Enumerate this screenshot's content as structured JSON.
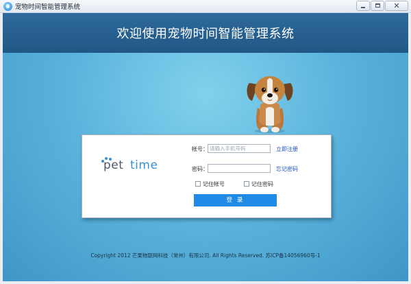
{
  "window": {
    "title": "宠物时间智能管理系统",
    "buttons": {
      "minimize": "minimize",
      "maximize": "maximize",
      "close": "✕"
    }
  },
  "header": {
    "title": "欢迎使用宠物时间智能管理系统"
  },
  "logo": {
    "text": "pet time"
  },
  "login": {
    "account_label": "帐号：",
    "account_placeholder": "请输入手机号码",
    "register_link": "立即注册",
    "password_label": "密码：",
    "password_value": "",
    "forgot_link": "忘记密码",
    "remember_account": "记住帐号",
    "remember_password": "记住密码",
    "submit": "登 录"
  },
  "footer": {
    "copyright": "Copyright 2012 芒果物联网科技（常州）有限公司. All Rights Reserved. 苏ICP备14056960号-1"
  },
  "colors": {
    "header_bg": "#205784",
    "stage_bg": "#5db5dd",
    "button_bg": "#1f8be6",
    "link": "#1f4fbf",
    "logo_gray": "#4e5866",
    "logo_blue": "#3a8fd0"
  },
  "icons": [
    "app-icon",
    "minimize-icon",
    "maximize-icon",
    "close-icon",
    "pet-time-logo",
    "puppy-image"
  ]
}
